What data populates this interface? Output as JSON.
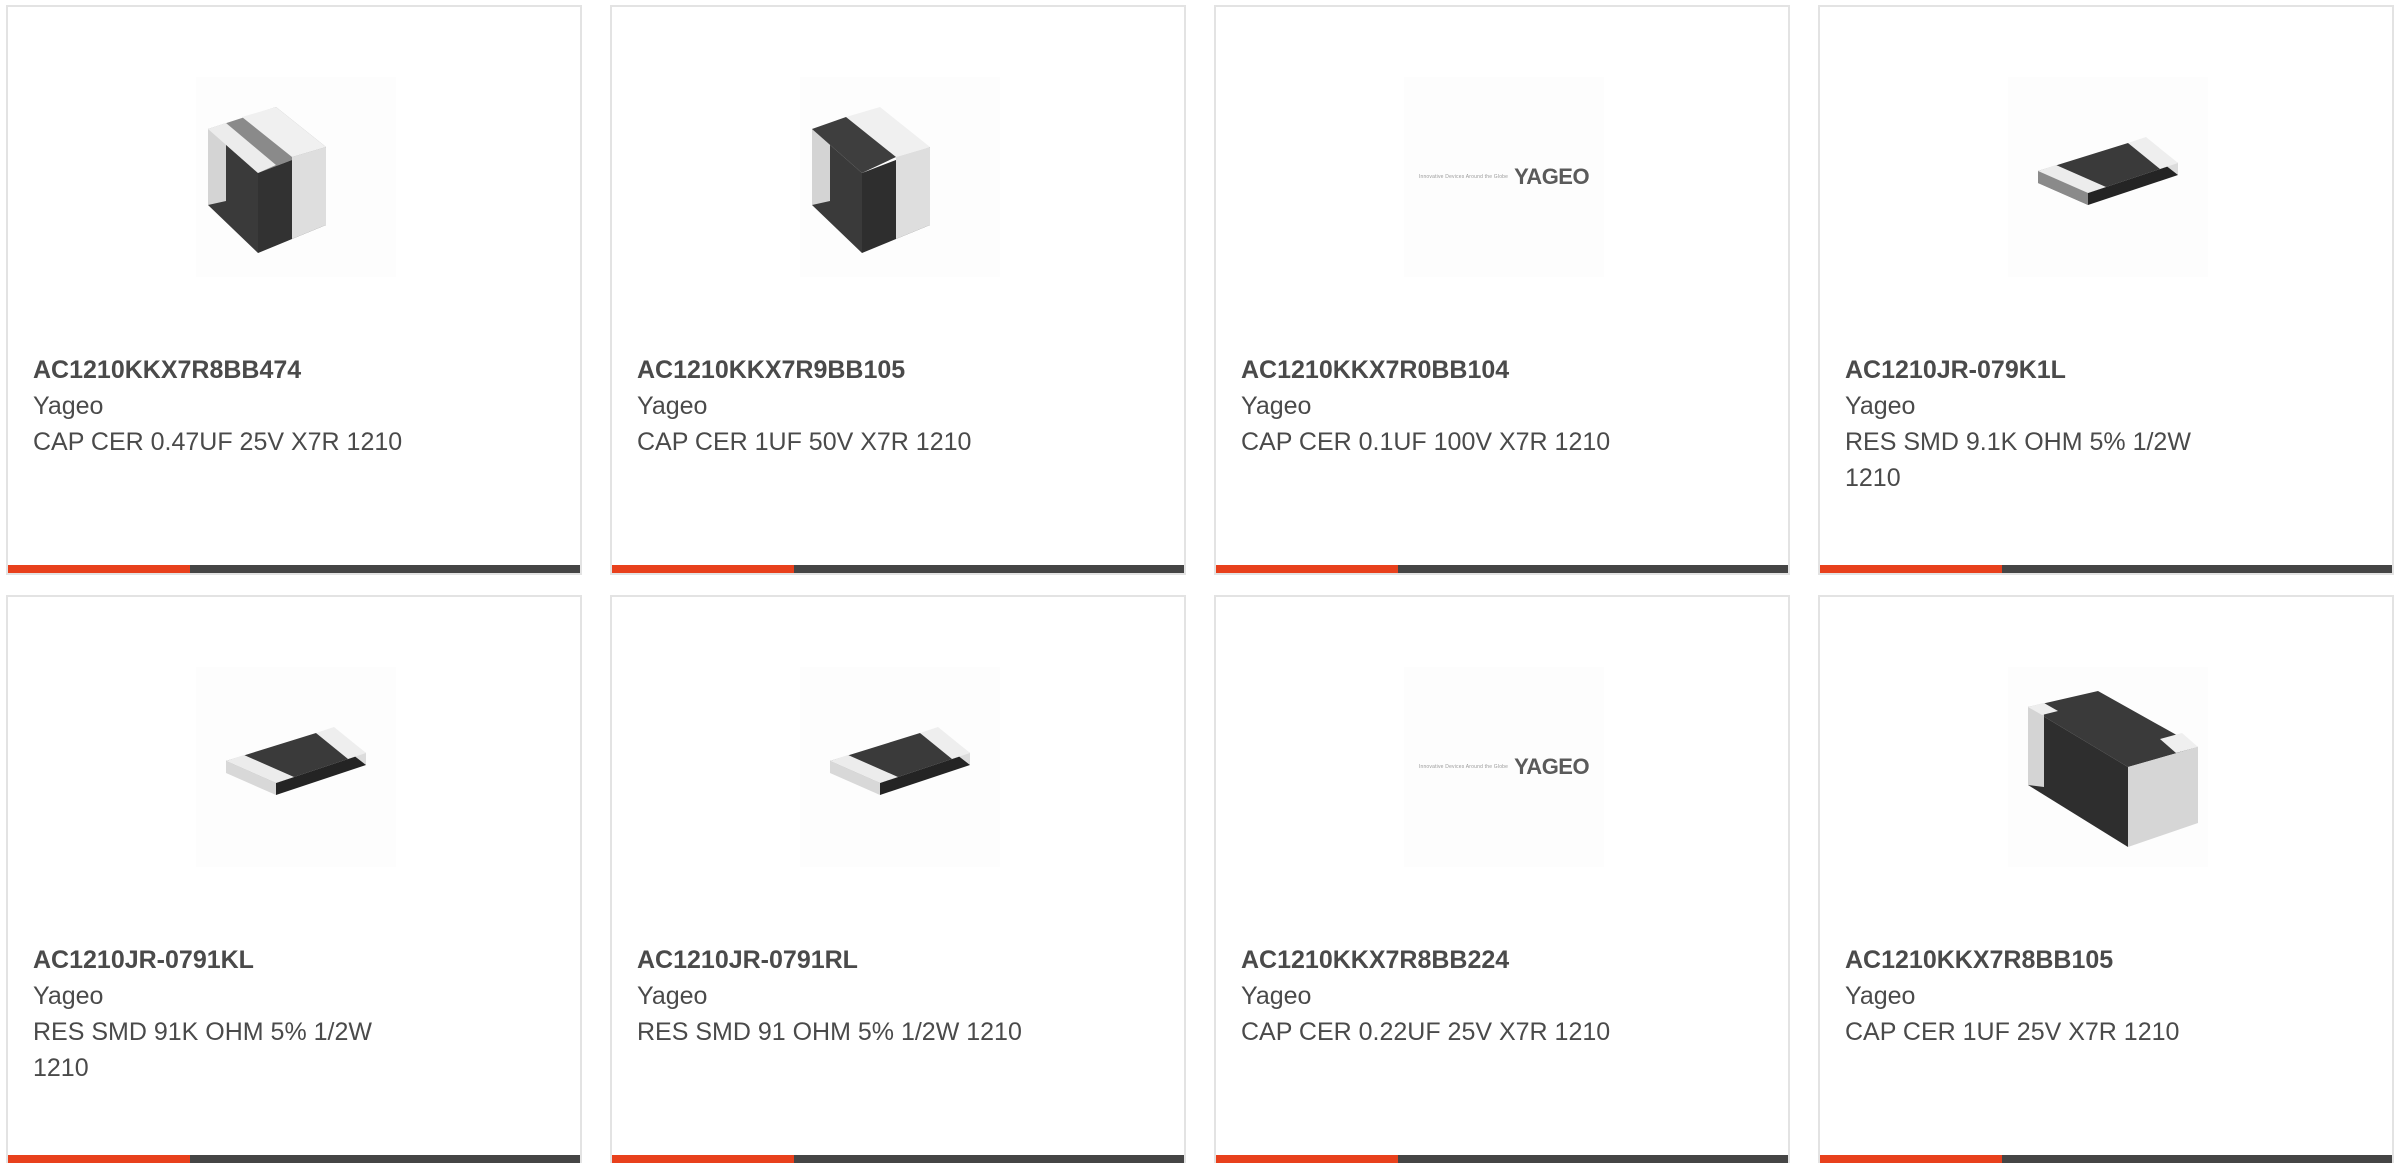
{
  "colors": {
    "accent": "#e8401c",
    "bar": "#454545",
    "border": "#e3e3e3",
    "text": "#4a4a4a"
  },
  "products": [
    {
      "part_number": "AC1210KKX7R8BB474",
      "manufacturer": "Yageo",
      "description": "CAP CER 0.47UF 25V X7R 1210",
      "image": "capacitor-chip-image"
    },
    {
      "part_number": "AC1210KKX7R9BB105",
      "manufacturer": "Yageo",
      "description": "CAP CER 1UF 50V X7R 1210",
      "image": "capacitor-chip-image"
    },
    {
      "part_number": "AC1210KKX7R0BB104",
      "manufacturer": "Yageo",
      "description": "CAP CER 0.1UF 100V X7R 1210",
      "image": "yageo-logo",
      "logo_tagline": "Innovative Devices Around the Globe",
      "logo_text": "YAGEO"
    },
    {
      "part_number": "AC1210JR-079K1L",
      "manufacturer": "Yageo",
      "description": "RES SMD 9.1K OHM 5% 1/2W 1210",
      "image": "resistor-chip-image"
    },
    {
      "part_number": "AC1210JR-0791KL",
      "manufacturer": "Yageo",
      "description": "RES SMD 91K OHM 5% 1/2W 1210",
      "image": "resistor-chip-image"
    },
    {
      "part_number": "AC1210JR-0791RL",
      "manufacturer": "Yageo",
      "description": "RES SMD 91 OHM 5% 1/2W 1210",
      "image": "resistor-chip-image"
    },
    {
      "part_number": "AC1210KKX7R8BB224",
      "manufacturer": "Yageo",
      "description": "CAP CER 0.22UF 25V X7R 1210",
      "image": "yageo-logo",
      "logo_tagline": "Innovative Devices Around the Globe",
      "logo_text": "YAGEO"
    },
    {
      "part_number": "AC1210KKX7R8BB105",
      "manufacturer": "Yageo",
      "description": "CAP CER 1UF 25V X7R 1210",
      "image": "capacitor-chip-image"
    }
  ]
}
